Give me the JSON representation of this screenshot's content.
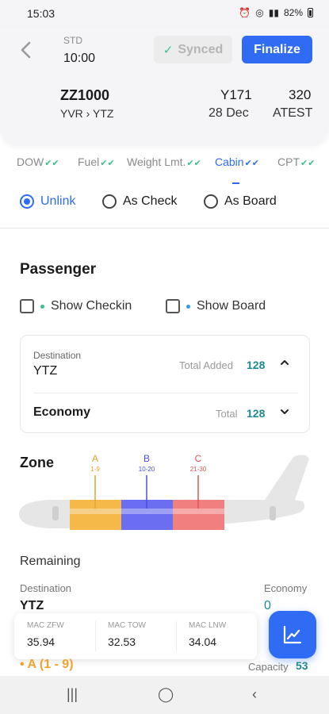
{
  "status": {
    "time": "15:03",
    "battery": "82%",
    "icons": [
      "alarm-icon",
      "hotspot-icon",
      "signal-icon"
    ]
  },
  "header": {
    "std_label": "STD",
    "std_time": "10:00",
    "synced_label": "Synced",
    "finalize_label": "Finalize",
    "flight_no": "ZZ1000",
    "route": "YVR › YTZ",
    "registration": "Y171",
    "date": "28 Dec",
    "aircraft_type": "320",
    "aircraft": "ATEST"
  },
  "tabs": [
    {
      "label": "DOW",
      "checked": true
    },
    {
      "label": "Fuel",
      "checked": true
    },
    {
      "label": "Weight Lmt.",
      "checked": true
    },
    {
      "label": "Cabin",
      "checked": true,
      "active": true
    },
    {
      "label": "CPT",
      "checked": true
    }
  ],
  "mode": {
    "options": [
      "Unlink",
      "As Check",
      "As Board"
    ],
    "selected": "Unlink"
  },
  "passenger": {
    "title": "Passenger",
    "show_checkin": "Show Checkin",
    "show_board": "Show Board",
    "checkin_color": "#3cc08a",
    "board_color": "#2f9cf3",
    "destination_label": "Destination",
    "destination": "YTZ",
    "total_added_label": "Total Added",
    "total_added": "128",
    "class": "Economy",
    "total_label": "Total",
    "total": "128"
  },
  "zone": {
    "title": "Zone",
    "zones": [
      {
        "label": "A",
        "rows": "1-9",
        "color": "#f5b94a"
      },
      {
        "label": "B",
        "rows": "10-20",
        "color": "#6b6ef0"
      },
      {
        "label": "C",
        "rows": "21-30",
        "color": "#f27f7f"
      }
    ]
  },
  "remaining": {
    "title": "Remaining",
    "destination_label": "Destination",
    "class_label": "Economy",
    "destination": "YTZ",
    "value": "0"
  },
  "mac": [
    {
      "label": "MAC ZFW",
      "value": "35.94"
    },
    {
      "label": "MAC TOW",
      "value": "32.53"
    },
    {
      "label": "MAC LNW",
      "value": "34.04"
    }
  ],
  "zone_row": {
    "label": "A (1 - 9)",
    "capacity_label": "Capacity",
    "capacity": "53"
  },
  "colors": {
    "accent": "#2f6cf3",
    "teal": "#1f8a8a",
    "check_green": "#3cc08a"
  }
}
